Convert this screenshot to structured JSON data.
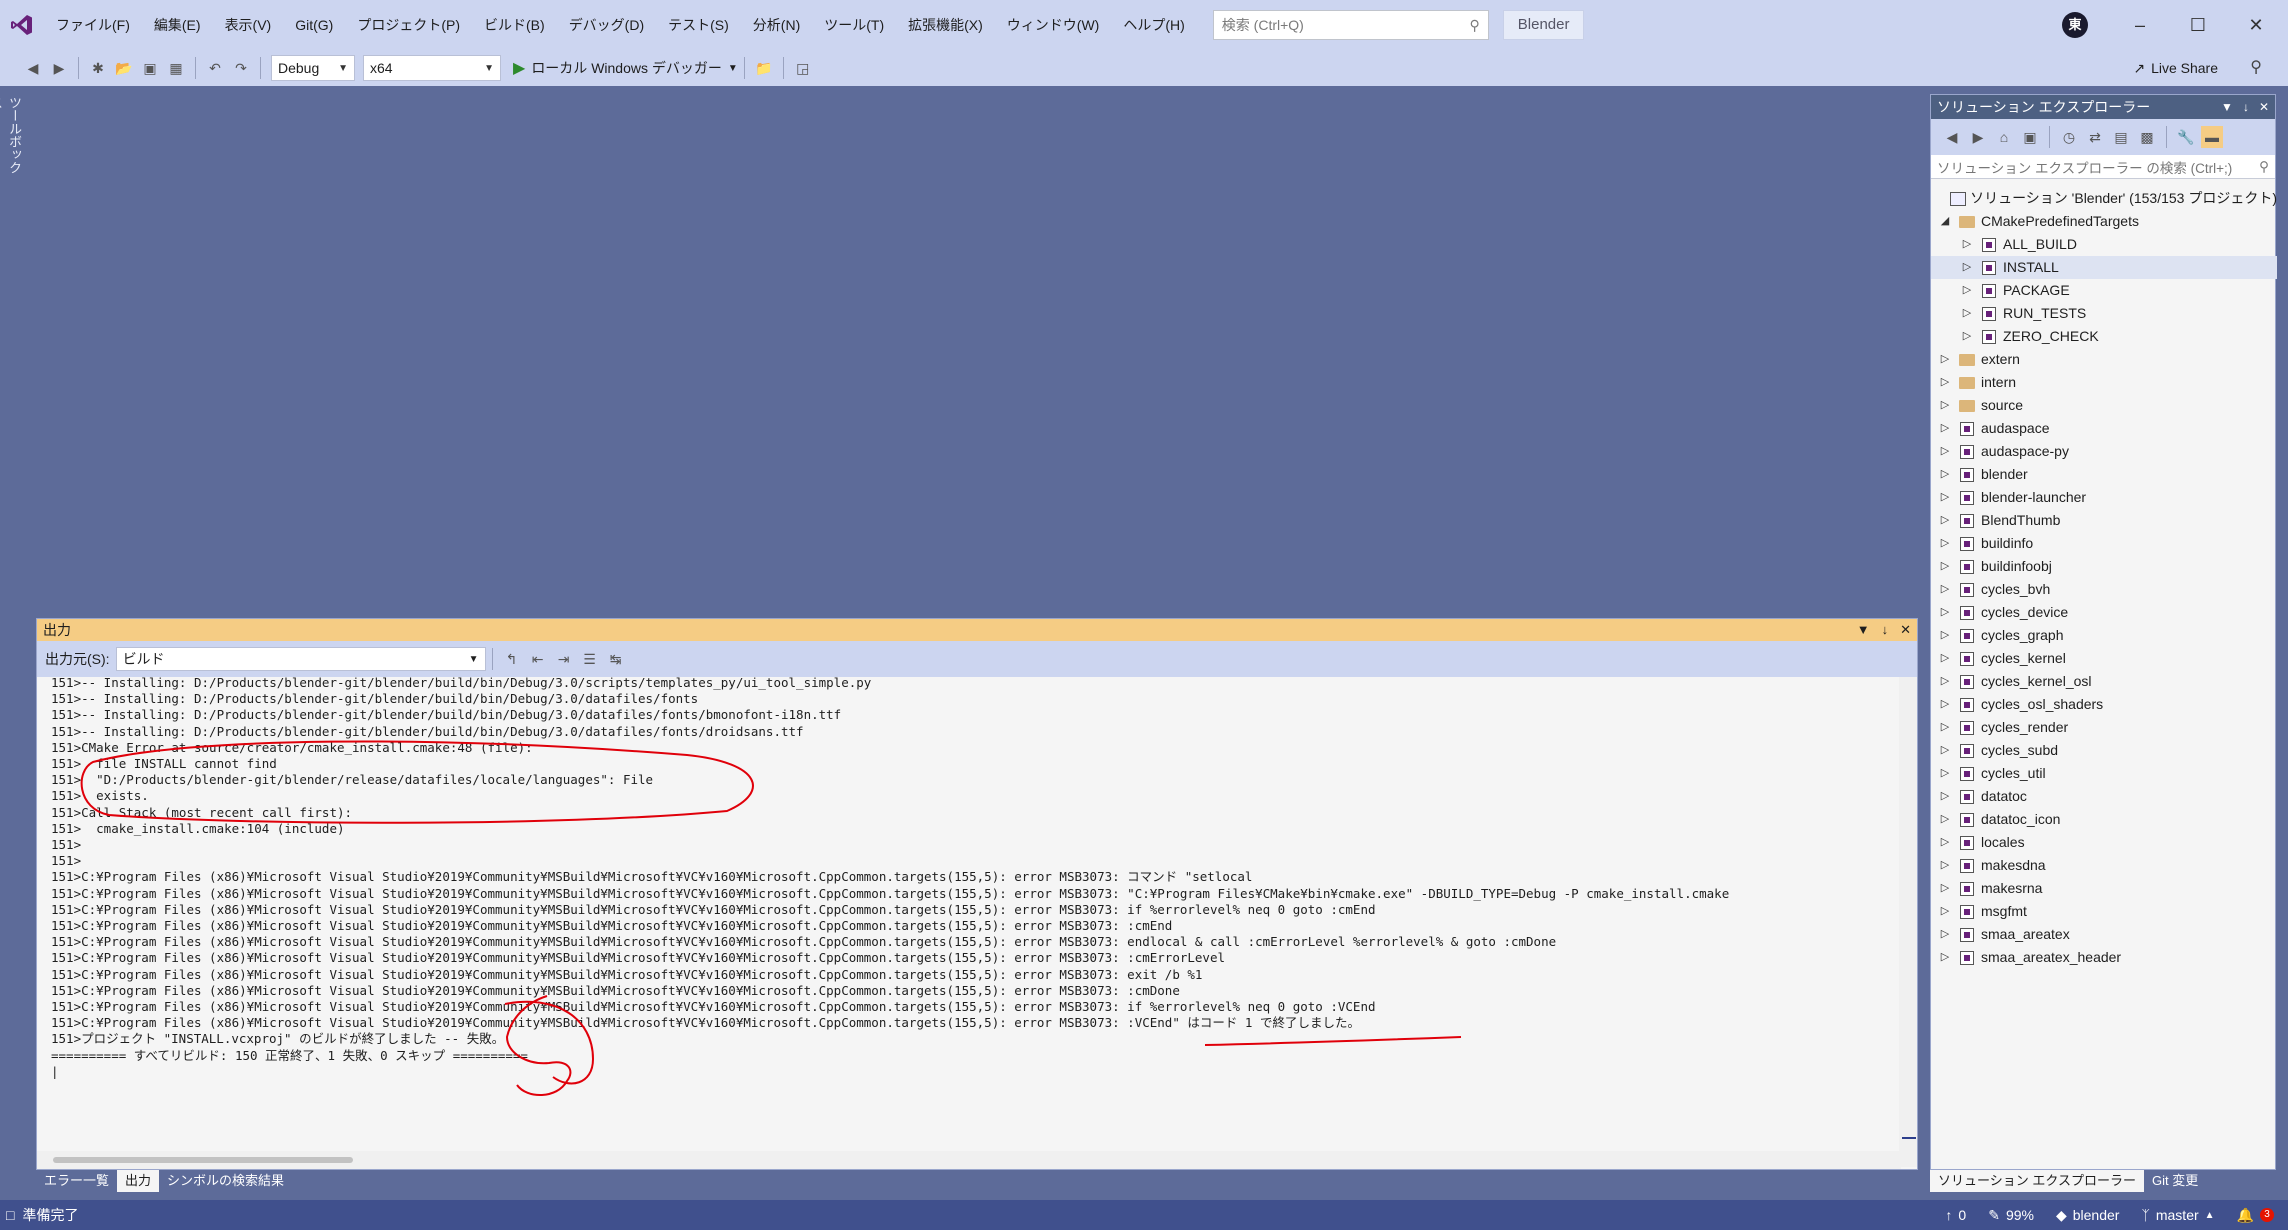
{
  "menu": {
    "items": [
      "ファイル(F)",
      "編集(E)",
      "表示(V)",
      "Git(G)",
      "プロジェクト(P)",
      "ビルド(B)",
      "デバッグ(D)",
      "テスト(S)",
      "分析(N)",
      "ツール(T)",
      "拡張機能(X)",
      "ウィンドウ(W)",
      "ヘルプ(H)"
    ],
    "search_placeholder": "検索 (Ctrl+Q)",
    "solution_name": "Blender",
    "account_initial": "東"
  },
  "toolbar": {
    "config": "Debug",
    "platform": "x64",
    "debug_target": "ローカル Windows デバッガー",
    "live_share": "Live Share"
  },
  "toolbox": {
    "label": "ツールボックス"
  },
  "output": {
    "title": "出力",
    "source_label": "出力元(S):",
    "source_value": "ビルド",
    "lines": [
      "151>-- Installing: D:/Products/blender-git/blender/build/bin/Debug/3.0/scripts/templates_py/ui_tool_simple.py",
      "151>-- Installing: D:/Products/blender-git/blender/build/bin/Debug/3.0/datafiles/fonts",
      "151>-- Installing: D:/Products/blender-git/blender/build/bin/Debug/3.0/datafiles/fonts/bmonofont-i18n.ttf",
      "151>-- Installing: D:/Products/blender-git/blender/build/bin/Debug/3.0/datafiles/fonts/droidsans.ttf",
      "151>CMake Error at source/creator/cmake_install.cmake:48 (file):",
      "151>  file INSTALL cannot find",
      "151>  \"D:/Products/blender-git/blender/release/datafiles/locale/languages\": File",
      "151>  exists.",
      "151>Call Stack (most recent call first):",
      "151>  cmake_install.cmake:104 (include)",
      "151>",
      "151>",
      "151>C:¥Program Files (x86)¥Microsoft Visual Studio¥2019¥Community¥MSBuild¥Microsoft¥VC¥v160¥Microsoft.CppCommon.targets(155,5): error MSB3073: コマンド \"setlocal",
      "151>C:¥Program Files (x86)¥Microsoft Visual Studio¥2019¥Community¥MSBuild¥Microsoft¥VC¥v160¥Microsoft.CppCommon.targets(155,5): error MSB3073: \"C:¥Program Files¥CMake¥bin¥cmake.exe\" -DBUILD_TYPE=Debug -P cmake_install.cmake",
      "151>C:¥Program Files (x86)¥Microsoft Visual Studio¥2019¥Community¥MSBuild¥Microsoft¥VC¥v160¥Microsoft.CppCommon.targets(155,5): error MSB3073: if %errorlevel% neq 0 goto :cmEnd",
      "151>C:¥Program Files (x86)¥Microsoft Visual Studio¥2019¥Community¥MSBuild¥Microsoft¥VC¥v160¥Microsoft.CppCommon.targets(155,5): error MSB3073: :cmEnd",
      "151>C:¥Program Files (x86)¥Microsoft Visual Studio¥2019¥Community¥MSBuild¥Microsoft¥VC¥v160¥Microsoft.CppCommon.targets(155,5): error MSB3073: endlocal & call :cmErrorLevel %errorlevel% & goto :cmDone",
      "151>C:¥Program Files (x86)¥Microsoft Visual Studio¥2019¥Community¥MSBuild¥Microsoft¥VC¥v160¥Microsoft.CppCommon.targets(155,5): error MSB3073: :cmErrorLevel",
      "151>C:¥Program Files (x86)¥Microsoft Visual Studio¥2019¥Community¥MSBuild¥Microsoft¥VC¥v160¥Microsoft.CppCommon.targets(155,5): error MSB3073: exit /b %1",
      "151>C:¥Program Files (x86)¥Microsoft Visual Studio¥2019¥Community¥MSBuild¥Microsoft¥VC¥v160¥Microsoft.CppCommon.targets(155,5): error MSB3073: :cmDone",
      "151>C:¥Program Files (x86)¥Microsoft Visual Studio¥2019¥Community¥MSBuild¥Microsoft¥VC¥v160¥Microsoft.CppCommon.targets(155,5): error MSB3073: if %errorlevel% neq 0 goto :VCEnd",
      "151>C:¥Program Files (x86)¥Microsoft Visual Studio¥2019¥Community¥MSBuild¥Microsoft¥VC¥v160¥Microsoft.CppCommon.targets(155,5): error MSB3073: :VCEnd\" はコード 1 で終了しました。",
      "151>プロジェクト \"INSTALL.vcxproj\" のビルドが終了しました -- 失敗。",
      "========== すべてリビルド: 150 正常終了、1 失敗、0 スキップ ==========",
      "|"
    ],
    "tabs": [
      "エラー一覧",
      "出力",
      "シンボルの検索結果"
    ]
  },
  "solution_explorer": {
    "title": "ソリューション エクスプローラー",
    "search_placeholder": "ソリューション エクスプローラー の検索 (Ctrl+;)",
    "root": "ソリューション 'Blender' (153/153 プロジェクト)",
    "folder": "CMakePredefinedTargets",
    "targets": [
      "ALL_BUILD",
      "INSTALL",
      "PACKAGE",
      "RUN_TESTS",
      "ZERO_CHECK"
    ],
    "folders": [
      "extern",
      "intern",
      "source"
    ],
    "projects": [
      "audaspace",
      "audaspace-py",
      "blender",
      "blender-launcher",
      "BlendThumb",
      "buildinfo",
      "buildinfoobj",
      "cycles_bvh",
      "cycles_device",
      "cycles_graph",
      "cycles_kernel",
      "cycles_kernel_osl",
      "cycles_osl_shaders",
      "cycles_render",
      "cycles_subd",
      "cycles_util",
      "datatoc",
      "datatoc_icon",
      "locales",
      "makesdna",
      "makesrna",
      "msgfmt",
      "smaa_areatex",
      "smaa_areatex_header"
    ],
    "tabs": [
      "ソリューション エクスプローラー",
      "Git 変更"
    ]
  },
  "status": {
    "ready": "準備完了",
    "up_count": "0",
    "percent": "99%",
    "repo": "blender",
    "branch": "master",
    "notifications": "3"
  }
}
